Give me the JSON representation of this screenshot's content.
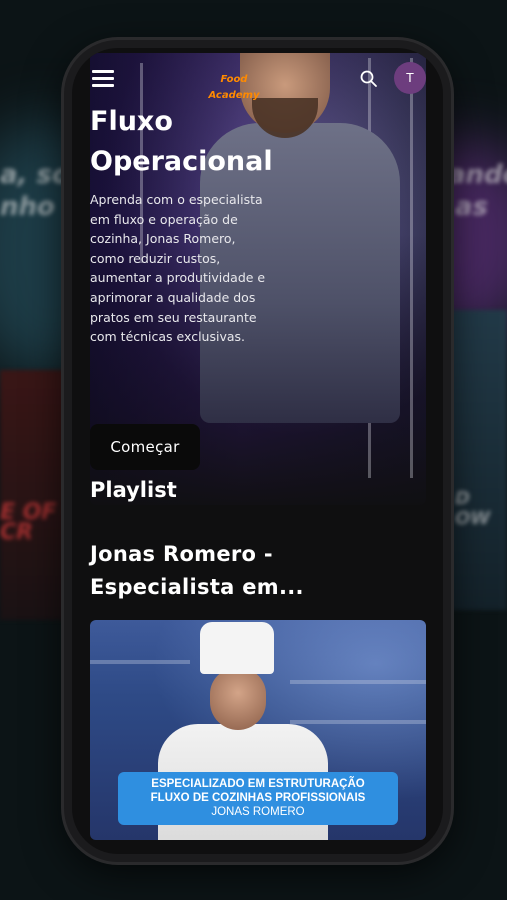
{
  "header": {
    "logo_label": "Food Academy",
    "avatar_initial": "T"
  },
  "hero": {
    "title": "Fluxo Operacional",
    "description": "Aprenda com o especialista em fluxo e operação de cozinha, Jonas Romero, como reduzir custos, aumentar a produtividade e aprimorar a qualidade dos pratos em seu restaurante com técnicas exclusivas.",
    "button_label": "Começar"
  },
  "playlist": {
    "heading": "Playlist",
    "item_title": "Jonas Romero - Especialista em...",
    "thumbnail": {
      "banner_line1": "ESPECIALIZADO EM ESTRUTURAÇÃO",
      "banner_line2": "FLUXO DE COZINHAS PROFISSIONAIS",
      "banner_line3": "JONAS ROMERO"
    }
  },
  "colors": {
    "accent": "#ff8a00",
    "avatar_bg": "#6d3d7e",
    "banner_bg": "#2f8fe0"
  }
}
